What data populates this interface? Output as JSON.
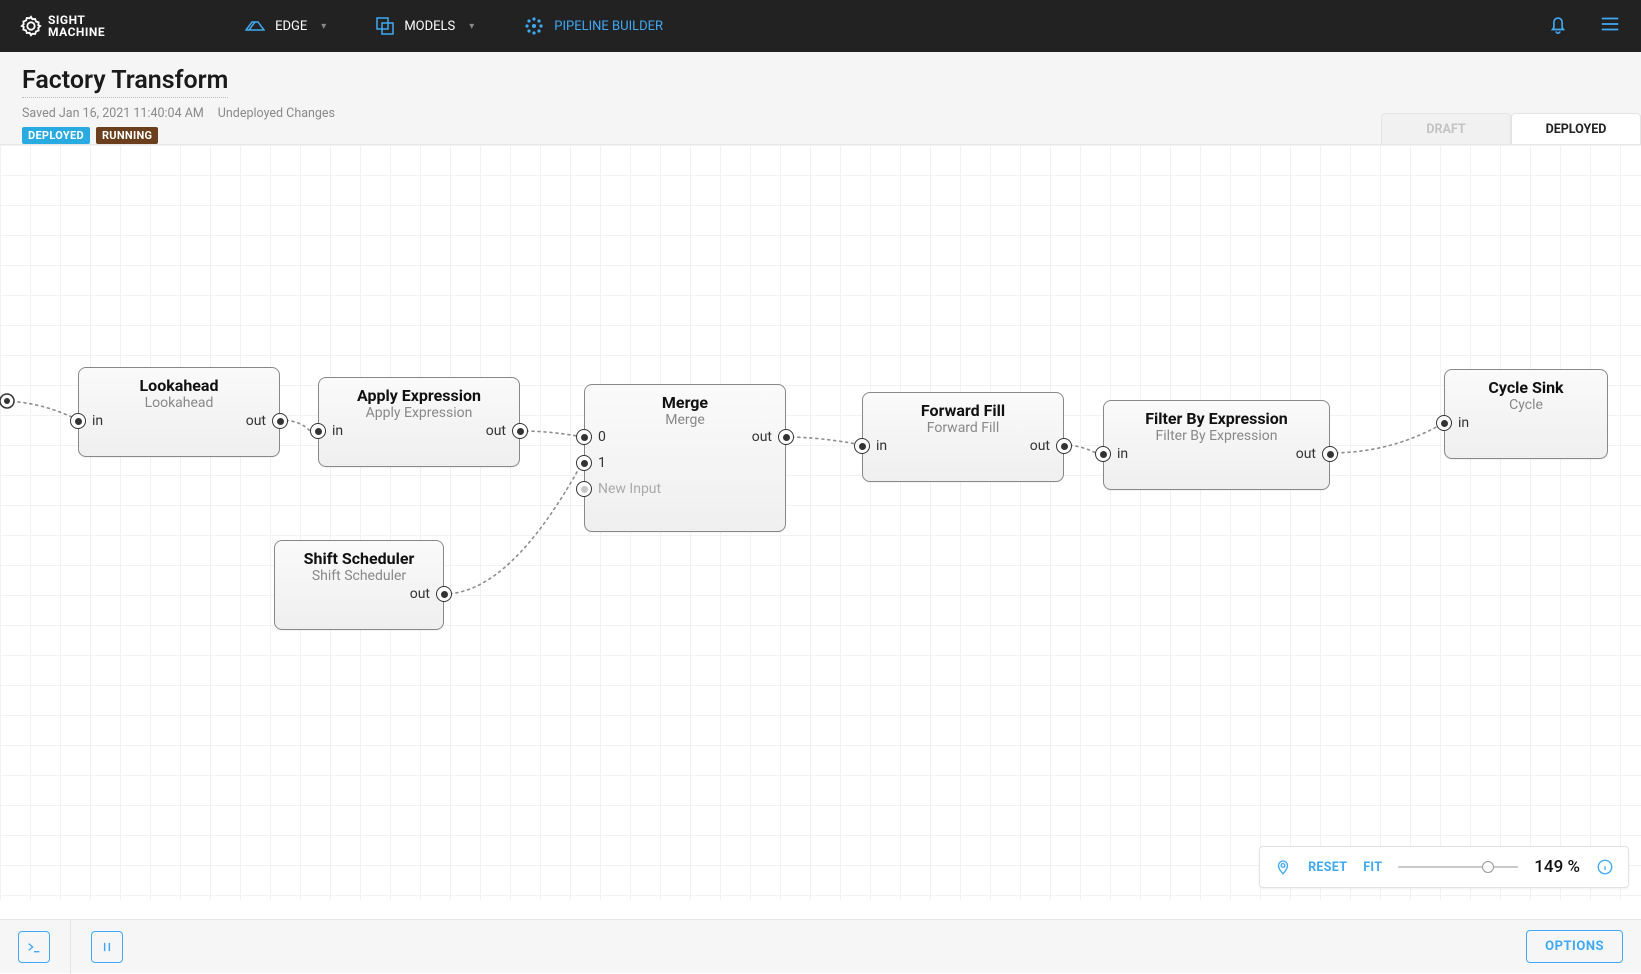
{
  "brand": {
    "name1": "SIGHT",
    "name2": "MACHINE"
  },
  "nav": {
    "edge": "EDGE",
    "models": "MODELS",
    "pipeline_builder": "PIPELINE BUILDER"
  },
  "header": {
    "title": "Factory Transform",
    "saved": "Saved Jan 16, 2021 11:40:04 AM",
    "undeployed": "Undeployed Changes",
    "badge_deployed": "DEPLOYED",
    "badge_running": "RUNNING",
    "tab_draft": "DRAFT",
    "tab_deployed": "DEPLOYED"
  },
  "nodes": {
    "lookahead": {
      "title": "Lookahead",
      "sub": "Lookahead",
      "in": "in",
      "out": "out"
    },
    "apply_expr": {
      "title": "Apply Expression",
      "sub": "Apply Expression",
      "in": "in",
      "out": "out"
    },
    "shift_sched": {
      "title": "Shift Scheduler",
      "sub": "Shift Scheduler",
      "out": "out"
    },
    "merge": {
      "title": "Merge",
      "sub": "Merge",
      "p0": "0",
      "p1": "1",
      "new_input": "New Input",
      "out": "out"
    },
    "forward_fill": {
      "title": "Forward Fill",
      "sub": "Forward Fill",
      "in": "in",
      "out": "out"
    },
    "filter_expr": {
      "title": "Filter By Expression",
      "sub": "Filter By Expression",
      "in": "in",
      "out": "out"
    },
    "cycle_sink": {
      "title": "Cycle Sink",
      "sub": "Cycle",
      "in": "in"
    }
  },
  "zoom": {
    "reset": "RESET",
    "fit": "FIT",
    "value": "149 %",
    "thumb_pct": 70
  },
  "bottom": {
    "options": "OPTIONS"
  }
}
